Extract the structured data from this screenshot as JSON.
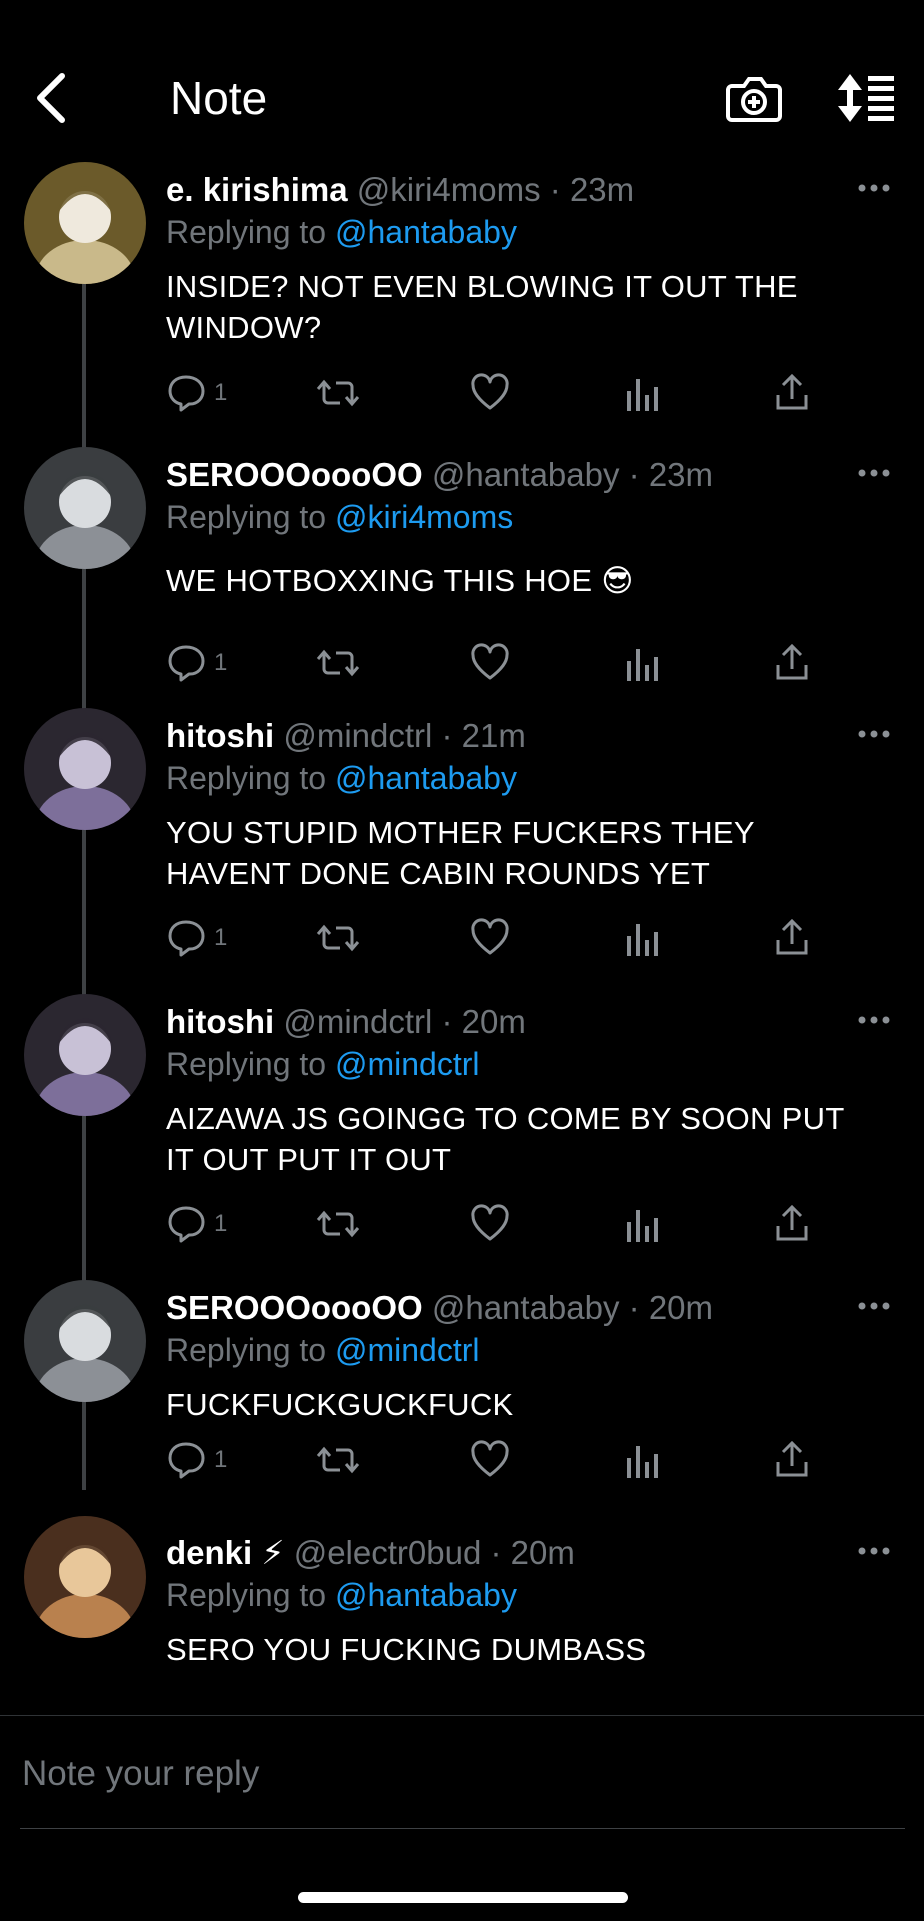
{
  "header": {
    "title": "Note",
    "back_icon": "chevron-left-icon",
    "camera_icon": "camera-plus-icon",
    "sort_icon": "sort-list-icon"
  },
  "colors": {
    "background": "#000000",
    "link": "#1d9bf0",
    "muted": "#71767b",
    "text": "#ffffff"
  },
  "tweets": [
    {
      "name": "e. kirishima",
      "handle": "@kiri4moms",
      "time": "23m",
      "replying_prefix": "Replying to",
      "replying_to": "@hantababy",
      "text_lines": [
        "INSIDE? NOT EVEN BLOWING IT OUT THE",
        "WINDOW?"
      ],
      "reply_count": "1"
    },
    {
      "name": "SEROOOoooOO",
      "handle": "@hantababy",
      "time": "23m",
      "replying_prefix": "Replying to",
      "replying_to": "@kiri4moms",
      "text_lines": [
        "WE HOTBOXXING THIS HOE 😎"
      ],
      "reply_count": "1"
    },
    {
      "name": "hitoshi",
      "handle": "@mindctrl",
      "time": "21m",
      "replying_prefix": "Replying to",
      "replying_to": "@hantababy",
      "text_lines": [
        "YOU STUPID MOTHER FUCKERS THEY",
        "HAVENT DONE CABIN ROUNDS YET"
      ],
      "reply_count": "1"
    },
    {
      "name": "hitoshi",
      "handle": "@mindctrl",
      "time": "20m",
      "replying_prefix": "Replying to",
      "replying_to": "@mindctrl",
      "text_lines": [
        "AIZAWA JS GOINGG TO COME BY SOON PUT",
        "IT OUT PUT IT OUT"
      ],
      "reply_count": "1"
    },
    {
      "name": "SEROOOoooOO",
      "handle": "@hantababy",
      "time": "20m",
      "replying_prefix": "Replying to",
      "replying_to": "@mindctrl",
      "text_lines": [
        "FUCKFUCKGUCKFUCK"
      ],
      "reply_count": "1"
    },
    {
      "name": "denki ⚡",
      "handle": "@electr0bud",
      "time": "20m",
      "replying_prefix": "Replying to",
      "replying_to": "@hantababy",
      "text_lines": [
        "SERO YOU FUCKING DUMBASS"
      ],
      "reply_count": ""
    }
  ],
  "reply": {
    "placeholder": "Note your reply"
  }
}
